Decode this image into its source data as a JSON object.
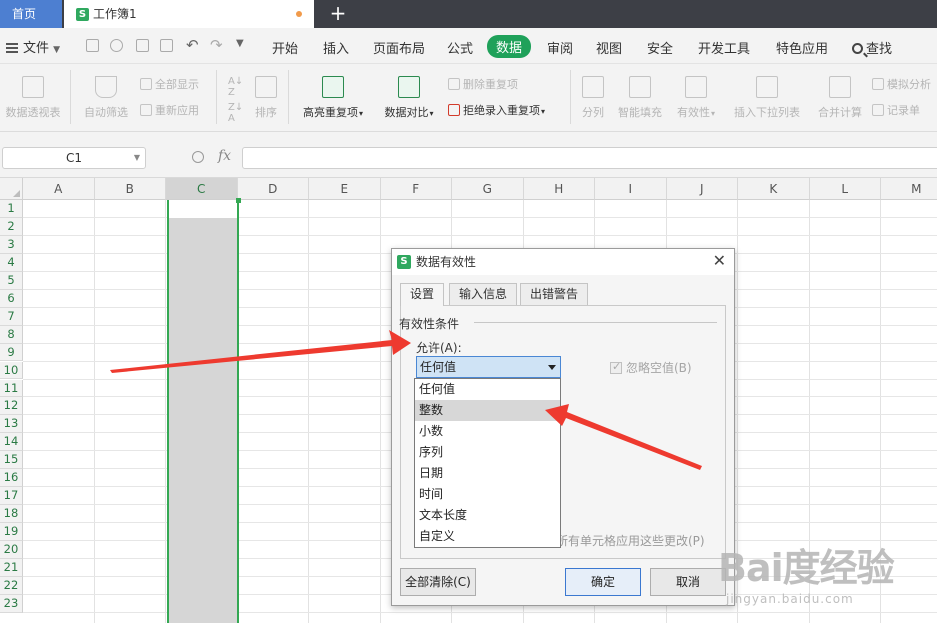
{
  "tabs": {
    "home": "首页",
    "doc": "工作簿1",
    "add": "+"
  },
  "menu": {
    "file": "文件",
    "items": [
      "开始",
      "插入",
      "页面布局",
      "公式",
      "数据",
      "审阅",
      "视图",
      "安全",
      "开发工具",
      "特色应用"
    ],
    "active": "数据",
    "search": "查找"
  },
  "ribbon": {
    "pivot": "数据透视表",
    "autofilter": "自动筛选",
    "show_all": "全部显示",
    "reapply": "重新应用",
    "sort": "排序",
    "highlight_dup": "高亮重复项",
    "compare": "数据对比",
    "remove_dup": "删除重复项",
    "reject_dup": "拒绝录入重复项",
    "split": "分列",
    "smart_fill": "智能填充",
    "validity": "有效性",
    "insert_dropdown": "插入下拉列表",
    "consolidate": "合并计算",
    "simulate": "模拟分析",
    "record": "记录单"
  },
  "formula_bar": {
    "name_box": "C1",
    "fx": "fx",
    "value": ""
  },
  "grid": {
    "columns": [
      "A",
      "B",
      "C",
      "D",
      "E",
      "F",
      "G",
      "H",
      "I",
      "J",
      "K",
      "L",
      "M"
    ],
    "selected_column": "C",
    "rows": [
      "1",
      "2",
      "3",
      "4",
      "5",
      "6",
      "7",
      "8",
      "9",
      "10",
      "11",
      "12",
      "13",
      "14",
      "15",
      "16",
      "17",
      "18",
      "19",
      "20",
      "21",
      "22",
      "23"
    ]
  },
  "dialog": {
    "title": "数据有效性",
    "close": "✕",
    "tabs": [
      "设置",
      "输入信息",
      "出错警告"
    ],
    "active_tab": "设置",
    "group_title": "有效性条件",
    "allow_label": "允许(A):",
    "allow_value": "任何值",
    "ignore_blank": "忽略空值(B)",
    "apply_all": "所有单元格应用这些更改(P)",
    "clear_all": "全部清除(C)",
    "ok": "确定",
    "cancel": "取消"
  },
  "dropdown": {
    "options": [
      "任何值",
      "整数",
      "小数",
      "序列",
      "日期",
      "时间",
      "文本长度",
      "自定义"
    ],
    "highlighted": "整数"
  },
  "watermark": {
    "brand": "Bai度经验",
    "url": "jingyan.baidu.com"
  },
  "colors": {
    "accent": "#1fa15a",
    "arrow": "#ee3a2f",
    "selection": "#34a853"
  }
}
